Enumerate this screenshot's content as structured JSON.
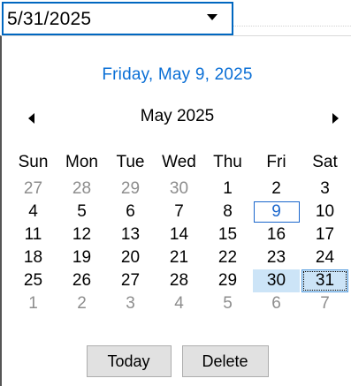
{
  "combo": {
    "value": "5/31/2025"
  },
  "calendar": {
    "today_heading": "Friday, May 9, 2025",
    "month_title": "May 2025",
    "days_of_week": [
      "Sun",
      "Mon",
      "Tue",
      "Wed",
      "Thu",
      "Fri",
      "Sat"
    ],
    "weeks": [
      [
        {
          "d": "27",
          "other": true
        },
        {
          "d": "28",
          "other": true
        },
        {
          "d": "29",
          "other": true
        },
        {
          "d": "30",
          "other": true
        },
        {
          "d": "1"
        },
        {
          "d": "2"
        },
        {
          "d": "3"
        }
      ],
      [
        {
          "d": "4"
        },
        {
          "d": "5"
        },
        {
          "d": "6"
        },
        {
          "d": "7"
        },
        {
          "d": "8"
        },
        {
          "d": "9",
          "today": true
        },
        {
          "d": "10"
        }
      ],
      [
        {
          "d": "11"
        },
        {
          "d": "12"
        },
        {
          "d": "13"
        },
        {
          "d": "14"
        },
        {
          "d": "15"
        },
        {
          "d": "16"
        },
        {
          "d": "17"
        }
      ],
      [
        {
          "d": "18"
        },
        {
          "d": "19"
        },
        {
          "d": "20"
        },
        {
          "d": "21"
        },
        {
          "d": "22"
        },
        {
          "d": "23"
        },
        {
          "d": "24"
        }
      ],
      [
        {
          "d": "25"
        },
        {
          "d": "26"
        },
        {
          "d": "27"
        },
        {
          "d": "28"
        },
        {
          "d": "29"
        },
        {
          "d": "30",
          "selected": true
        },
        {
          "d": "31",
          "selected": true,
          "focused": true
        }
      ],
      [
        {
          "d": "1",
          "other": true
        },
        {
          "d": "2",
          "other": true
        },
        {
          "d": "3",
          "other": true
        },
        {
          "d": "4",
          "other": true
        },
        {
          "d": "5",
          "other": true
        },
        {
          "d": "6",
          "other": true
        },
        {
          "d": "7",
          "other": true
        }
      ]
    ],
    "buttons": {
      "today": "Today",
      "delete": "Delete"
    }
  },
  "icons": {
    "dropdown": "chevron-down-icon",
    "prev": "previous-month-icon",
    "next": "next-month-icon"
  },
  "colors": {
    "accent": "#0067c0",
    "today_heading": "#0a6fd6",
    "selection": "#cce4f7",
    "other_month": "#8d8d8d"
  }
}
